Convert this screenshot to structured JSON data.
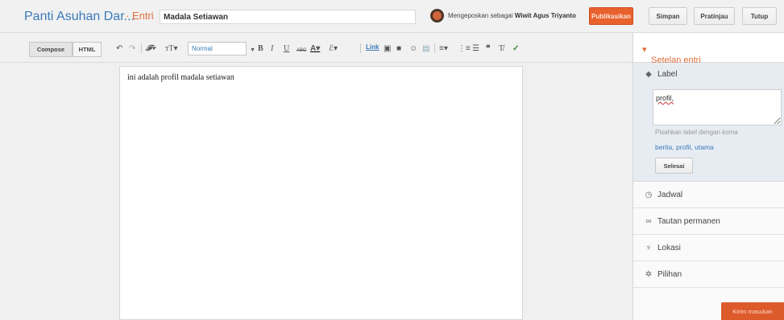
{
  "header": {
    "blog_title": "Panti Asuhan Dar...",
    "entry_label": "· Entri",
    "post_title_value": "Madala Setiawan",
    "posting_as_prefix": "Mengeposkan sebagai",
    "author_name": "Wiwit Agus Triyanto",
    "publish_label": "Publikasikan",
    "save_label": "Simpan",
    "preview_label": "Pratinjau",
    "close_label": "Tutup"
  },
  "toolbar": {
    "compose_label": "Compose",
    "html_label": "HTML",
    "font_size_value": "Normal",
    "link_label": "Link",
    "icons": [
      "undo-icon",
      "redo-icon",
      "font-family-icon",
      "font-size-icon",
      "bold-icon",
      "italic-icon",
      "underline-icon",
      "strikethrough-icon",
      "text-color-icon",
      "highlight-icon",
      "image-icon",
      "video-icon",
      "emoji-icon",
      "jump-break-icon",
      "align-icon",
      "numbered-list-icon",
      "bulleted-list-icon",
      "quote-icon",
      "clear-format-icon",
      "spellcheck-icon"
    ]
  },
  "editor": {
    "body_text": "ini adalah profil madala setiawan"
  },
  "sidebar": {
    "heading": "Setelan entri",
    "label_section": {
      "title": "Label",
      "value": "profil,",
      "hint": "Pisahkan label dengan koma",
      "suggestions": "berita, profil, utama",
      "done_label": "Selesai"
    },
    "items": [
      {
        "label": "Jadwal",
        "icon": "clock-icon"
      },
      {
        "label": "Tautan permanen",
        "icon": "link-icon"
      },
      {
        "label": "Lokasi",
        "icon": "location-pin-icon"
      },
      {
        "label": "Pilihan",
        "icon": "gear-icon"
      }
    ]
  },
  "feedback_label": "Kirim masukan",
  "colors": {
    "accent_orange": "#e8612d",
    "link_blue": "#3a7ab8",
    "label_panel_bg": "#e7ecf3"
  }
}
